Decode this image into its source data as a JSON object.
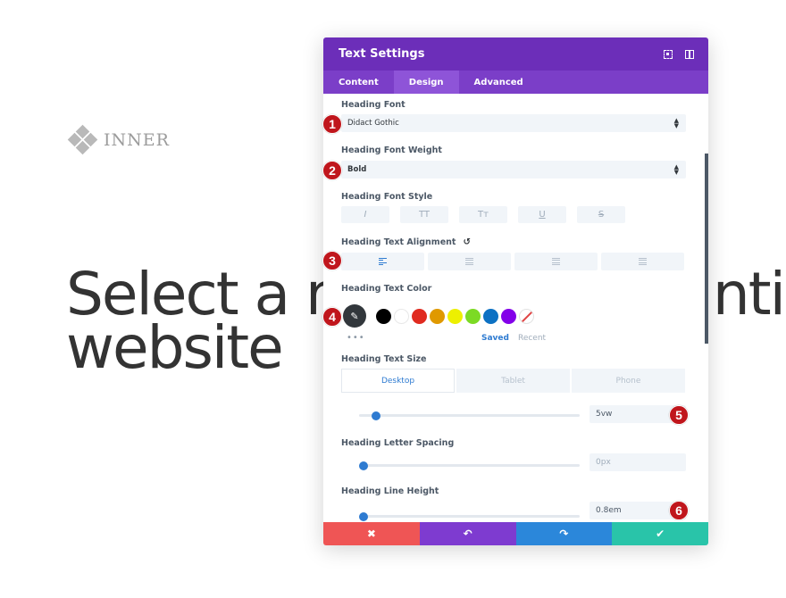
{
  "page": {
    "logo_text": "INNER",
    "hero_line1": "Select a mar",
    "hero_line1_tail": "ntin",
    "hero_line2": "website"
  },
  "modal": {
    "title": "Text Settings",
    "tabs": [
      "Content",
      "Design",
      "Advanced"
    ],
    "active_tab": "Design"
  },
  "fields": {
    "font_label": "Heading Font",
    "font_value": "Didact Gothic",
    "weight_label": "Heading Font Weight",
    "weight_value": "Bold",
    "style_label": "Heading Font Style",
    "style_buttons": [
      "I",
      "TT",
      "Tт",
      "U",
      "S"
    ],
    "align_label": "Heading Text Alignment",
    "color_label": "Heading Text Color",
    "colors": [
      "#000000",
      "#ffffff",
      "#e02b20",
      "#e09900",
      "#edf000",
      "#7cda24",
      "#0c71c3",
      "#8300e9"
    ],
    "saved_label": "Saved",
    "recent_label": "Recent",
    "size_label": "Heading Text Size",
    "device_tabs": [
      "Desktop",
      "Tablet",
      "Phone"
    ],
    "size_value": "5vw",
    "size_slider": 0.06,
    "spacing_label": "Heading Letter Spacing",
    "spacing_value": "0px",
    "spacing_slider": 0.0,
    "lineheight_label": "Heading Line Height",
    "lineheight_value": "0.8em",
    "lineheight_slider": 0.0
  },
  "footer": {
    "cancel_icon": "✖",
    "undo_icon": "↶",
    "redo_icon": "↷",
    "save_icon": "✔",
    "colors": [
      "#ef5555",
      "#7e3bd0",
      "#2b87da",
      "#29c4a9"
    ]
  },
  "markers": [
    "1",
    "2",
    "3",
    "4",
    "5",
    "6"
  ],
  "icons": {
    "reset": "↺",
    "eyedropper": "✎",
    "more": "•••"
  }
}
